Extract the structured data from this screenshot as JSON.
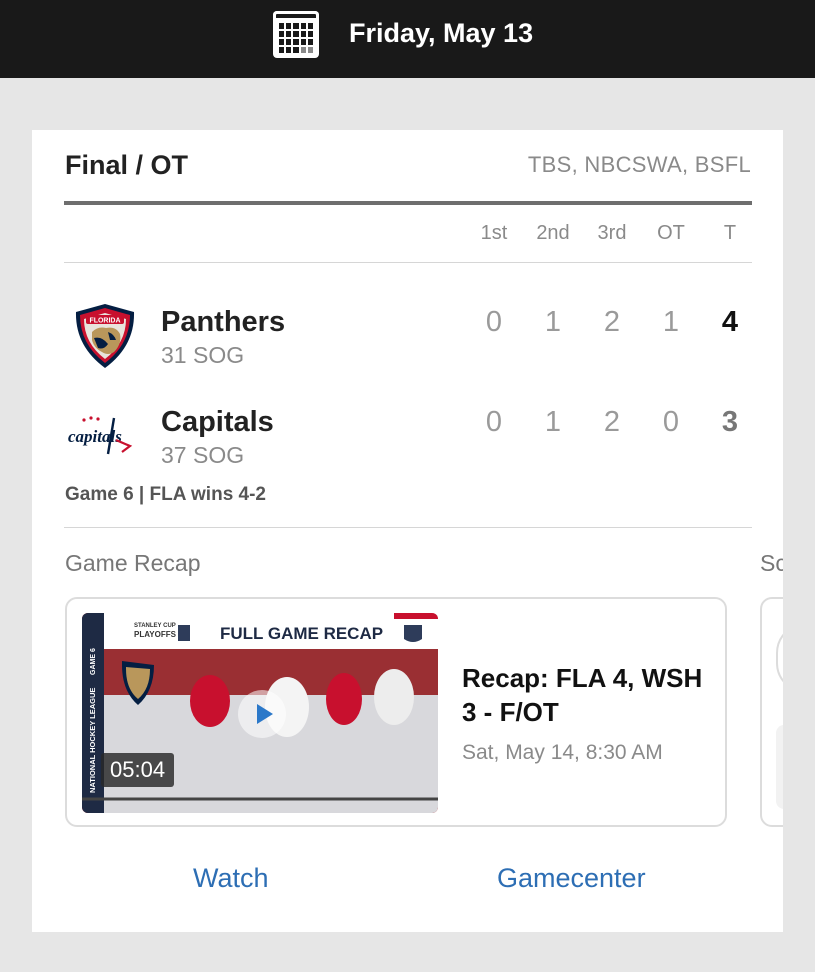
{
  "header": {
    "date": "Friday, May 13",
    "calendar_icon": "calendar-icon"
  },
  "game": {
    "status": "Final / OT",
    "networks": "TBS, NBCSWA, BSFL",
    "periods": [
      "1st",
      "2nd",
      "3rd",
      "OT",
      "T"
    ],
    "teams": [
      {
        "name": "Panthers",
        "sog": "31 SOG",
        "logo": "panthers-logo",
        "scores": [
          "0",
          "1",
          "2",
          "1",
          "4"
        ],
        "winner": true
      },
      {
        "name": "Capitals",
        "sog": "37 SOG",
        "logo": "capitals-logo",
        "logo_text": "capitals",
        "scores": [
          "0",
          "1",
          "2",
          "0",
          "3"
        ],
        "winner": false
      }
    ],
    "series_note": "Game 6 | FLA wins 4-2"
  },
  "recap": {
    "section_title": "Game Recap",
    "next_section_partial": "Sc",
    "thumbnail_banner": "FULL GAME RECAP",
    "thumbnail_badge_line1": "STANLEY CUP",
    "thumbnail_badge_line2": "PLAYOFFS",
    "thumbnail_side_text": "NATIONAL HOCKEY LEAGUE",
    "thumbnail_game_tag": "GAME 6",
    "thumbnail_logo_text": "FLORIDA",
    "duration": "05:04",
    "title": "Recap: FLA 4, WSH 3 - F/OT",
    "date": "Sat, May 14, 8:30 AM"
  },
  "actions": {
    "watch": "Watch",
    "gamecenter": "Gamecenter"
  },
  "colors": {
    "header_bg": "#191919",
    "page_bg": "#e6e6e6",
    "link": "#2d6eb4",
    "panthers_navy": "#041e42",
    "panthers_red": "#c8102e",
    "panthers_gold": "#b9975b"
  }
}
